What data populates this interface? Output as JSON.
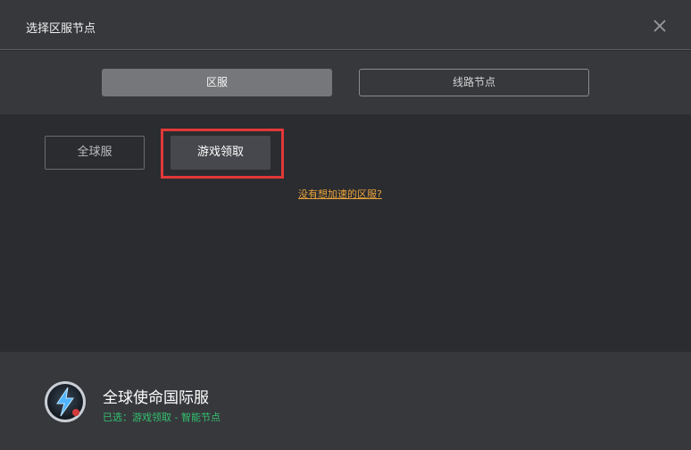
{
  "window": {
    "title": "选择区服节点",
    "close_icon": "close-icon"
  },
  "tabs": [
    {
      "label": "区服",
      "active": true
    },
    {
      "label": "线路节点",
      "active": false
    }
  ],
  "regions": {
    "global_label": "全球服",
    "game_label": "游戏领取",
    "highlight_color": "#e13838"
  },
  "missing_link": "没有想加速的区服?",
  "footer": {
    "game_name": "全球使命国际服",
    "selected_text": "已选：游戏领取 - 智能节点",
    "icon": "game-logo-icon"
  },
  "colors": {
    "accent_orange": "#e8a23a",
    "selected_green": "#32c26f"
  }
}
